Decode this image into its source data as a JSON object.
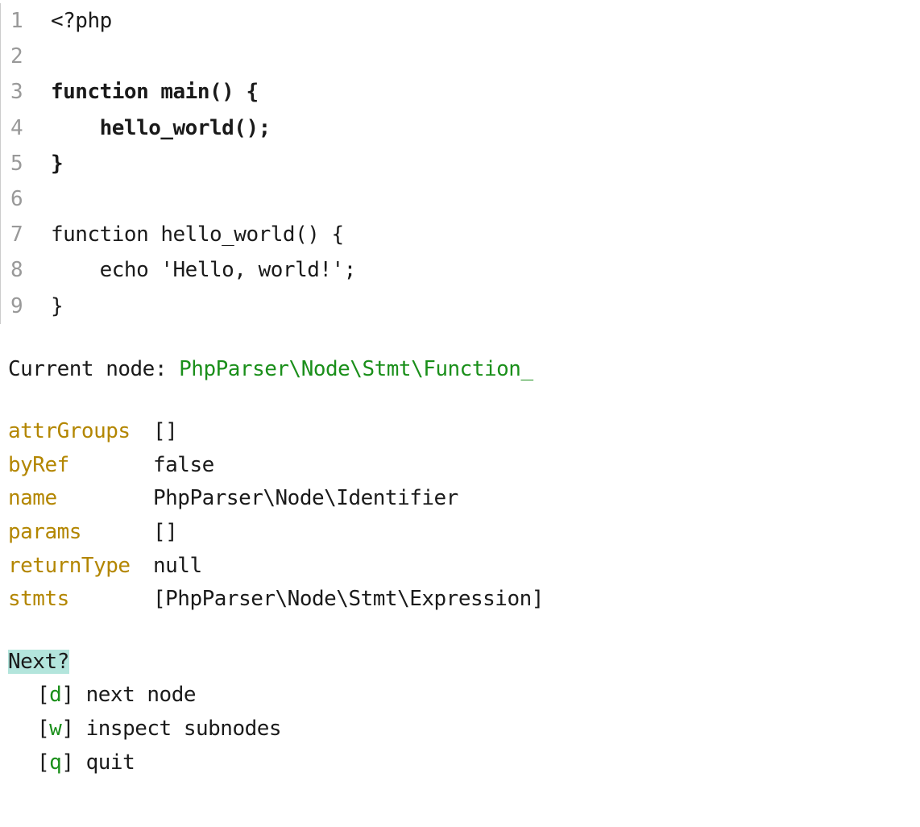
{
  "code": {
    "lines": [
      {
        "n": "1",
        "text": "<?php",
        "bold": false
      },
      {
        "n": "2",
        "text": "",
        "bold": false
      },
      {
        "n": "3",
        "text": "function main() {",
        "bold": true
      },
      {
        "n": "4",
        "text": "    hello_world();",
        "bold": true
      },
      {
        "n": "5",
        "text": "}",
        "bold": true
      },
      {
        "n": "6",
        "text": "",
        "bold": false
      },
      {
        "n": "7",
        "text": "function hello_world() {",
        "bold": false
      },
      {
        "n": "8",
        "text": "    echo 'Hello, world!';",
        "bold": false
      },
      {
        "n": "9",
        "text": "}",
        "bold": false
      }
    ]
  },
  "current_node": {
    "label": "Current node: ",
    "value": "PhpParser\\Node\\Stmt\\Function_"
  },
  "attrs": [
    {
      "key": "attrGroups",
      "value": "[]"
    },
    {
      "key": "byRef",
      "value": "false"
    },
    {
      "key": "name",
      "value": "PhpParser\\Node\\Identifier"
    },
    {
      "key": "params",
      "value": "[]"
    },
    {
      "key": "returnType",
      "value": "null"
    },
    {
      "key": "stmts",
      "value": "[PhpParser\\Node\\Stmt\\Expression]"
    }
  ],
  "prompt": {
    "label": "Next?",
    "options": [
      {
        "key": "d",
        "label": "next node"
      },
      {
        "key": "w",
        "label": "inspect subnodes"
      },
      {
        "key": "q",
        "label": "quit"
      }
    ]
  }
}
